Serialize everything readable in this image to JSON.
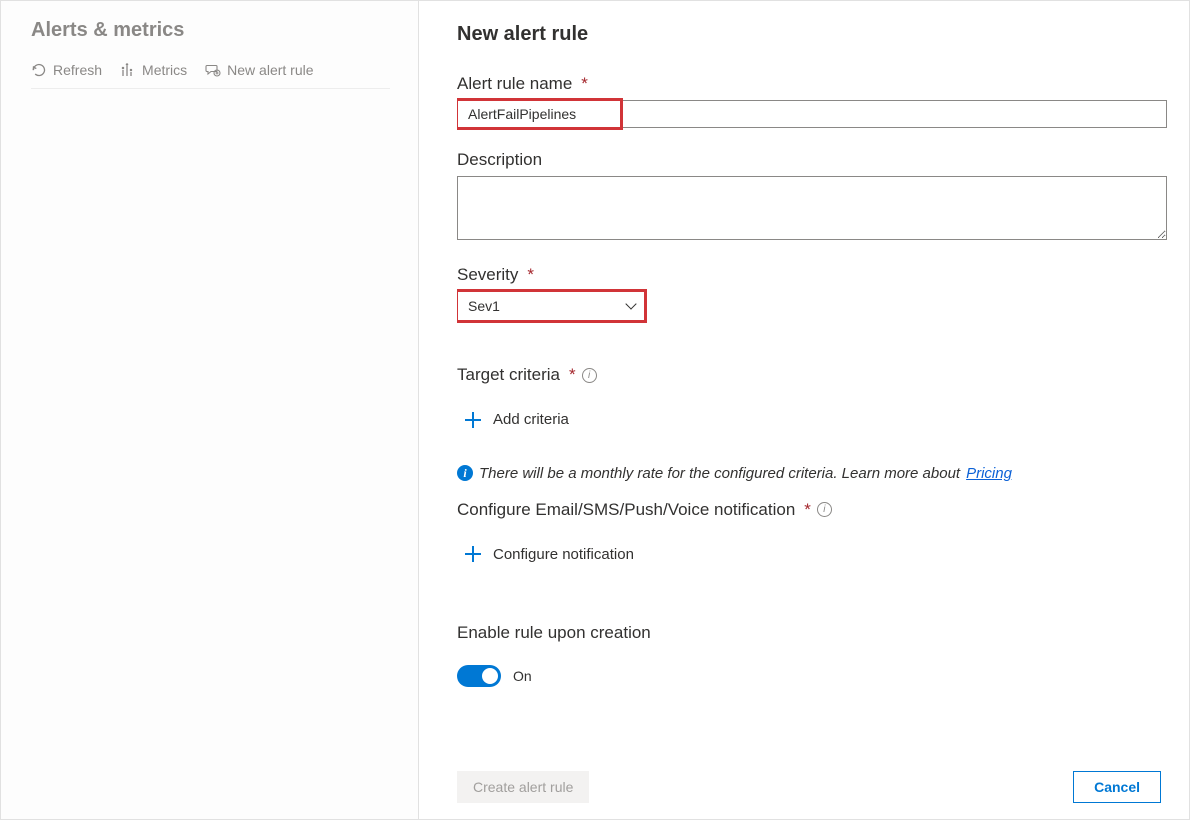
{
  "left": {
    "title": "Alerts & metrics",
    "toolbar": {
      "refresh": "Refresh",
      "metrics": "Metrics",
      "newAlert": "New alert rule"
    }
  },
  "form": {
    "heading": "New alert rule",
    "name": {
      "label": "Alert rule name",
      "value": "AlertFailPipelines"
    },
    "description": {
      "label": "Description",
      "value": ""
    },
    "severity": {
      "label": "Severity",
      "value": "Sev1"
    },
    "targetCriteria": {
      "label": "Target criteria",
      "addLabel": "Add criteria"
    },
    "pricingInfo": {
      "prefix": "There will be a monthly rate for the configured criteria. Learn more about ",
      "linkText": "Pricing"
    },
    "notification": {
      "label": "Configure Email/SMS/Push/Voice notification",
      "addLabel": "Configure notification"
    },
    "enableRule": {
      "label": "Enable rule upon creation",
      "stateLabel": "On"
    },
    "buttons": {
      "create": "Create alert rule",
      "cancel": "Cancel"
    }
  }
}
